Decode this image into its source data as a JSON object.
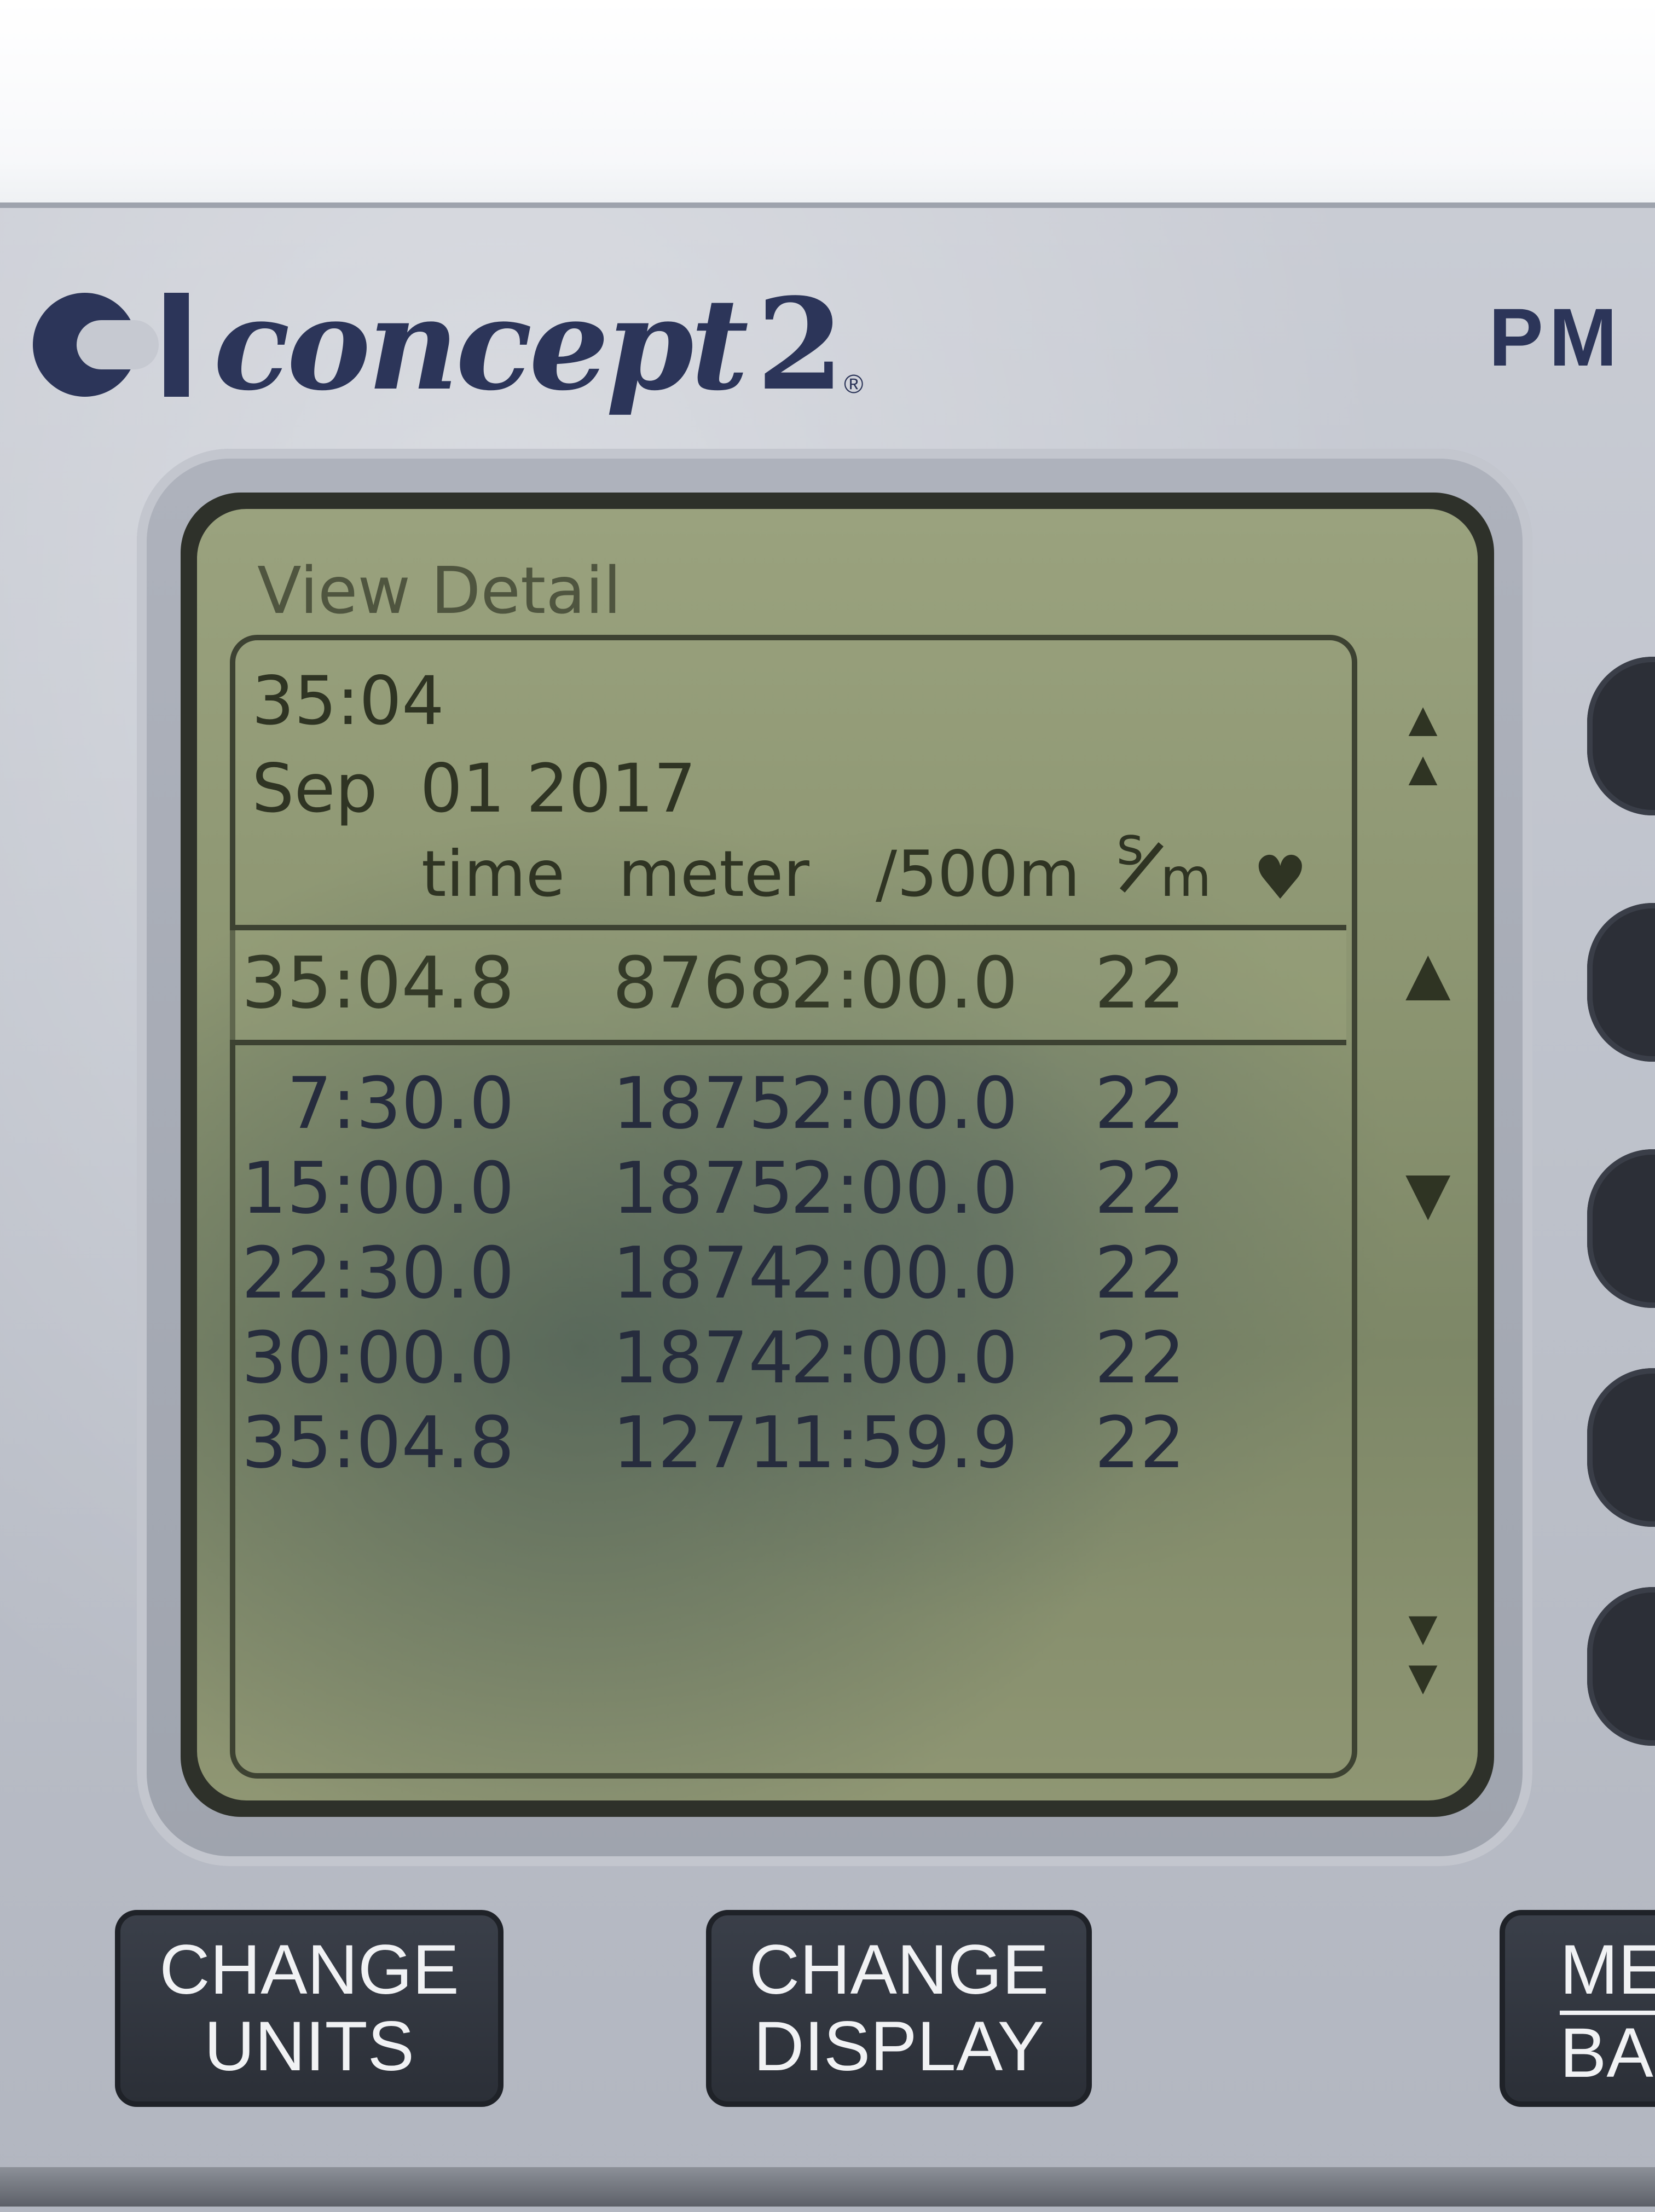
{
  "brand": {
    "name": "concept",
    "number": "2",
    "registered": "®",
    "model": "PM"
  },
  "screen": {
    "title": "View Detail",
    "summary": {
      "duration": "35:04",
      "date_month": "Sep",
      "date_day_year": "01 2017"
    },
    "columns": {
      "time": "time",
      "meter": "meter",
      "pace": "/500m",
      "spm_num": "s",
      "spm_den": "m",
      "heart_icon": "heart-icon"
    },
    "total_row": {
      "time": "35:04.8",
      "meter": "8768",
      "pace": "2:00.0",
      "spm": "22"
    },
    "splits": [
      {
        "time": "7:30.0",
        "meter": "1875",
        "pace": "2:00.0",
        "spm": "22"
      },
      {
        "time": "15:00.0",
        "meter": "1875",
        "pace": "2:00.0",
        "spm": "22"
      },
      {
        "time": "22:30.0",
        "meter": "1874",
        "pace": "2:00.0",
        "spm": "22"
      },
      {
        "time": "30:00.0",
        "meter": "1874",
        "pace": "2:00.0",
        "spm": "22"
      },
      {
        "time": "35:04.8",
        "meter": "1271",
        "pace": "1:59.9",
        "spm": "22"
      }
    ],
    "scroll_icons": [
      "page-up-icon",
      "line-up-icon",
      "line-down-icon",
      "page-down-icon"
    ]
  },
  "buttons": {
    "change_units_line1": "CHANGE",
    "change_units_line2": "UNITS",
    "change_display_line1": "CHANGE",
    "change_display_line2": "DISPLAY",
    "menu_line1": "ME",
    "menu_line2": "BA"
  },
  "colors": {
    "brand_navy": "#2c3559",
    "lcd_green": "#8d9672",
    "button_dark": "#2b2f37"
  }
}
